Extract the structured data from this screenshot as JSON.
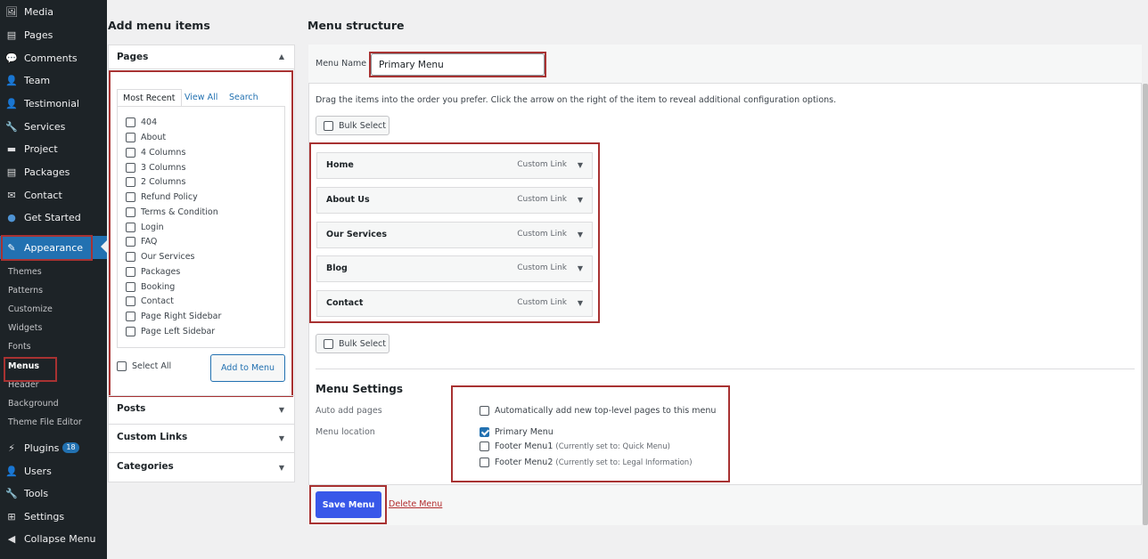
{
  "sidebar": {
    "items": [
      {
        "label": "Media",
        "icon": "media-icon",
        "glyph": "🖼"
      },
      {
        "label": "Pages",
        "icon": "pages-icon",
        "glyph": "▤"
      },
      {
        "label": "Comments",
        "icon": "comments-icon",
        "glyph": "💬"
      },
      {
        "label": "Team",
        "icon": "person-icon",
        "glyph": "👤"
      },
      {
        "label": "Testimonial",
        "icon": "person-icon",
        "glyph": "👤"
      },
      {
        "label": "Services",
        "icon": "wrench-icon",
        "glyph": "🔧"
      },
      {
        "label": "Project",
        "icon": "folder-icon",
        "glyph": "▬"
      },
      {
        "label": "Packages",
        "icon": "packages-icon",
        "glyph": "▤"
      },
      {
        "label": "Contact",
        "icon": "envelope-icon",
        "glyph": "✉"
      },
      {
        "label": "Get Started",
        "icon": "globe-icon",
        "glyph": "●"
      },
      {
        "label": "Appearance",
        "icon": "paintbrush-icon",
        "glyph": "✎"
      }
    ],
    "submenu": [
      "Themes",
      "Patterns",
      "Customize",
      "Widgets",
      "Fonts",
      "Menus",
      "Header",
      "Background",
      "Theme File Editor"
    ],
    "bottom_items": [
      {
        "label": "Plugins",
        "icon": "plugin-icon",
        "glyph": "⚡",
        "badge": "18"
      },
      {
        "label": "Users",
        "icon": "users-icon",
        "glyph": "👤"
      },
      {
        "label": "Tools",
        "icon": "tools-icon",
        "glyph": "🔧"
      },
      {
        "label": "Settings",
        "icon": "settings-icon",
        "glyph": "⊞"
      },
      {
        "label": "Collapse Menu",
        "icon": "collapse-icon",
        "glyph": "◀"
      }
    ]
  },
  "add_items": {
    "heading": "Add menu items",
    "pages_label": "Pages",
    "tabs": [
      "Most Recent",
      "View All",
      "Search"
    ],
    "pages": [
      "404",
      "About",
      "4 Columns",
      "3 Columns",
      "2 Columns",
      "Refund Policy",
      "Terms & Condition",
      "Login",
      "FAQ",
      "Our Services",
      "Packages",
      "Booking",
      "Contact",
      "Page Right Sidebar",
      "Page Left Sidebar"
    ],
    "select_all": "Select All",
    "add_button": "Add to Menu",
    "other_sections": [
      "Posts",
      "Custom Links",
      "Categories"
    ]
  },
  "structure": {
    "heading": "Menu structure",
    "menu_name_label": "Menu Name",
    "menu_name_value": "Primary Menu",
    "instructions": "Drag the items into the order you prefer. Click the arrow on the right of the item to reveal additional configuration options.",
    "bulk_select": "Bulk Select",
    "items": [
      {
        "title": "Home",
        "type": "Custom Link"
      },
      {
        "title": "About Us",
        "type": "Custom Link"
      },
      {
        "title": "Our Services",
        "type": "Custom Link"
      },
      {
        "title": "Blog",
        "type": "Custom Link"
      },
      {
        "title": "Contact",
        "type": "Custom Link"
      }
    ]
  },
  "settings": {
    "heading": "Menu Settings",
    "auto_add_label": "Auto add pages",
    "auto_add_text": "Automatically add new top-level pages to this menu",
    "location_label": "Menu location",
    "locations": [
      {
        "name": "Primary Menu",
        "note": "",
        "checked": true
      },
      {
        "name": "Footer Menu1",
        "note": "(Currently set to: Quick Menu)",
        "checked": false
      },
      {
        "name": "Footer Menu2",
        "note": "(Currently set to: Legal Information)",
        "checked": false
      }
    ]
  },
  "footer": {
    "save_button": "Save Menu",
    "delete_link": "Delete Menu"
  },
  "colors": {
    "accent": "#2271b1",
    "save_button": "#3858e9",
    "highlight": "#a83232",
    "sidebar_bg": "#1d2327"
  }
}
